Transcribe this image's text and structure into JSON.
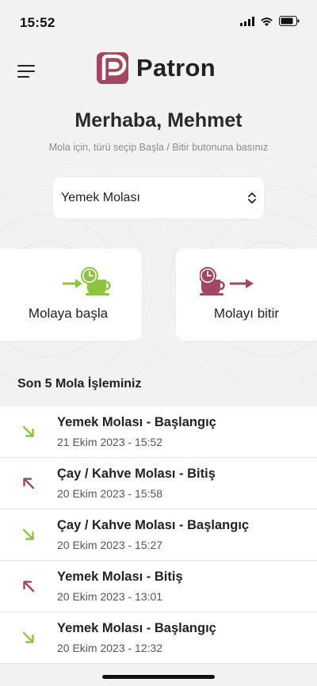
{
  "status_bar": {
    "time": "15:52"
  },
  "header": {
    "app_name": "Patron"
  },
  "greeting": "Merhaba, Mehmet",
  "subtitle": "Mola için, türü seçip Başla / Bitir butonuna basınız",
  "break_type": {
    "selected": "Yemek Molası"
  },
  "actions": {
    "start_label": "Molaya başla",
    "end_label": "Molayı bitir"
  },
  "history": {
    "title": "Son 5 Mola İşleminiz",
    "items": [
      {
        "title": "Yemek Molası - Başlangıç",
        "date": "21 Ekim 2023 - 15:52",
        "kind": "start"
      },
      {
        "title": "Çay / Kahve Molası - Bitiş",
        "date": "20 Ekim 2023 - 15:58",
        "kind": "end"
      },
      {
        "title": "Çay / Kahve Molası - Başlangıç",
        "date": "20 Ekim 2023 - 15:27",
        "kind": "start"
      },
      {
        "title": "Yemek Molası - Bitiş",
        "date": "20 Ekim 2023 - 13:01",
        "kind": "end"
      },
      {
        "title": "Yemek Molası - Başlangıç",
        "date": "20 Ekim 2023 - 12:32",
        "kind": "start"
      }
    ]
  },
  "colors": {
    "brand": "#a3465f",
    "start": "#8cc63f",
    "end": "#a3465f"
  }
}
